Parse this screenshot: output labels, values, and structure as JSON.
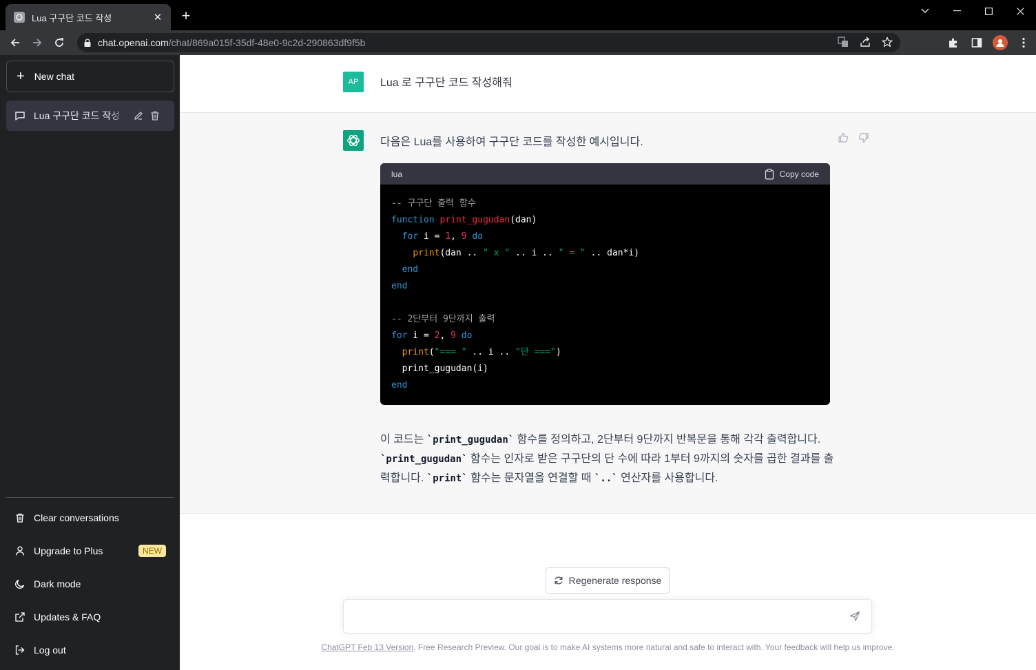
{
  "browser": {
    "tab_title": "Lua 구구단 코드 작성",
    "tab_close": "✕",
    "new_tab": "+",
    "url_host": "chat.openai.com",
    "url_path": "/chat/869a015f-35df-48e0-9c2d-290863df9f5b"
  },
  "sidebar": {
    "new_chat": "New chat",
    "conversations": [
      {
        "label": "Lua 구구단 코드 작성"
      }
    ],
    "links": {
      "clear": "Clear conversations",
      "upgrade": "Upgrade to Plus",
      "upgrade_badge": "NEW",
      "dark_mode": "Dark mode",
      "updates": "Updates & FAQ",
      "logout": "Log out"
    }
  },
  "chat": {
    "user_avatar": "AP",
    "user_message": "Lua 로 구구단 코드 작성해줘",
    "bot_intro": "다음은 Lua를 사용하여 구구단 코드를 작성한 예시입니다.",
    "code_lang": "lua",
    "copy_label": "Copy code",
    "code": {
      "l1": "-- 구구단 출력 함수",
      "l2_kw": "function",
      "l2_fn": "print_gugudan",
      "l2_rest": "(dan)",
      "l3_kw1": "for",
      "l3_a": " i = ",
      "l3_n1": "1",
      "l3_b": ", ",
      "l3_n2": "9",
      "l3_kw2": "do",
      "l4_fn": "print",
      "l4_a": "(dan .. ",
      "l4_s1": "\" x \"",
      "l4_b": " .. i .. ",
      "l4_s2": "\" = \"",
      "l4_c": " .. dan*i)",
      "l5": "end",
      "l6": "end",
      "l8": "-- 2단부터 9단까지 출력",
      "l9_kw1": "for",
      "l9_a": " i = ",
      "l9_n1": "2",
      "l9_b": ", ",
      "l9_n2": "9",
      "l9_kw2": "do",
      "l10_fn": "print",
      "l10_a": "(",
      "l10_s1": "\"=== \"",
      "l10_b": " .. i .. ",
      "l10_s2": "\"단 ===\"",
      "l10_c": ")",
      "l11": "print_gugudan(i)",
      "l12": "end"
    },
    "explain": {
      "p1": "이 코드는 ",
      "c1": "`print_gugudan`",
      "p2": " 함수를 정의하고, 2단부터 9단까지 반복문을 통해 각각 출력합니다. ",
      "c2": "`print_gugudan`",
      "p3": " 함수는 인자로 받은 구구단의 단 수에 따라 1부터 9까지의 숫자를 곱한 결과를 출력합니다. ",
      "c3": "`print`",
      "p4": " 함수는 문자열을 연결할 때 ",
      "c4": "`..`",
      "p5": " 연산자를 사용합니다."
    },
    "regenerate": "Regenerate response",
    "input_value": "",
    "footer_link": "ChatGPT Feb 13 Version",
    "footer_text": ". Free Research Preview. Our goal is to make AI systems more natural and safe to interact with. Your feedback will help us improve."
  },
  "colors": {
    "sidebar_bg": "#202123",
    "bot_row_bg": "#f7f7f8",
    "openai_green": "#10a37f",
    "user_avatar_bg": "#1abc9c"
  }
}
